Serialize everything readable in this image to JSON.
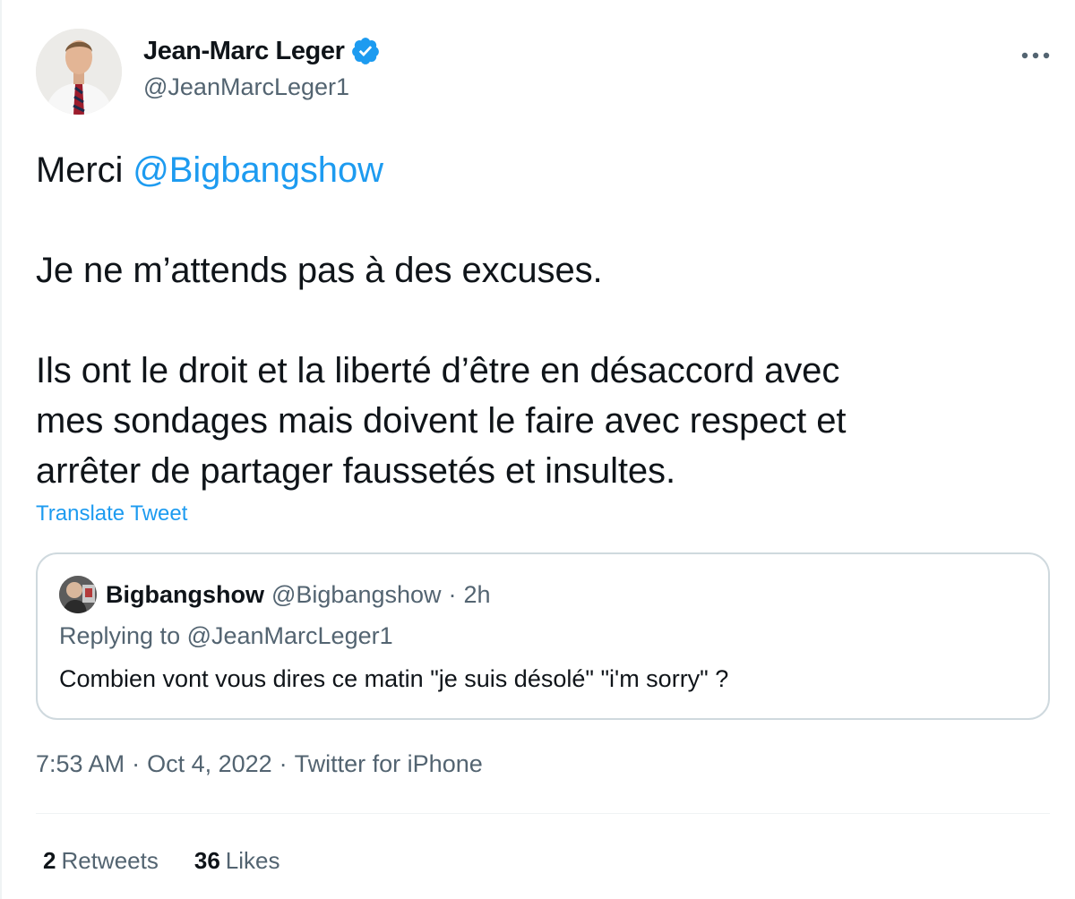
{
  "author": {
    "display_name": "Jean-Marc Leger",
    "handle": "@JeanMarcLeger1",
    "verified_icon": "verified-badge-icon",
    "avatar_icon": "profile-photo"
  },
  "more_icon": "more-options-icon",
  "tweet": {
    "line1_prefix": "Merci ",
    "line1_mention": "@Bigbangshow",
    "line2": "Je ne m’attends pas à des excuses.",
    "line3": "Ils ont le droit et la liberté d’être en désaccord avec",
    "line4": "mes sondages mais doivent le faire avec respect et",
    "line5": "arrêter de partager faussetés et insultes."
  },
  "translate_label": "Translate Tweet",
  "quoted": {
    "name": "Bigbangshow",
    "handle": "@Bigbangshow",
    "dot": "·",
    "time": "2h",
    "replying_to": "Replying to @JeanMarcLeger1",
    "text": "Combien vont vous dires ce matin \"je suis désolé\"  \"i'm sorry\" ?"
  },
  "meta": {
    "time": "7:53 AM",
    "sep": "·",
    "date": "Oct 4, 2022",
    "source": "Twitter for iPhone"
  },
  "stats": {
    "retweets_count": "2",
    "retweets_label": "Retweets",
    "likes_count": "36",
    "likes_label": "Likes"
  },
  "colors": {
    "accent": "#1d9bf0",
    "text": "#0f1419",
    "secondary": "#536471",
    "border": "#cfd9de"
  }
}
